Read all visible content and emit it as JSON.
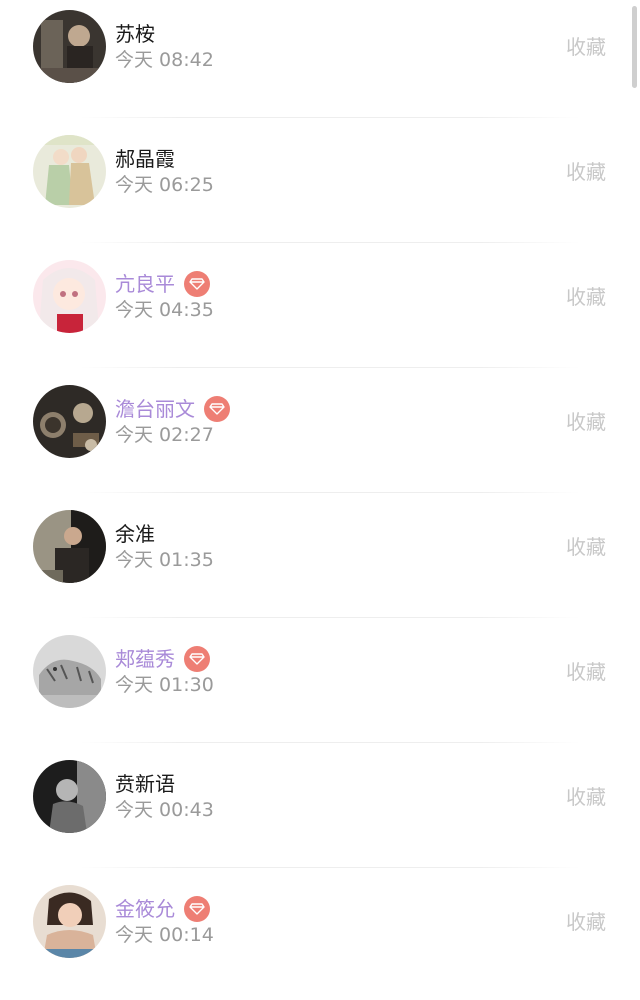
{
  "colors": {
    "vip_name": "#a98ad8",
    "vip_badge": "#ee7e74",
    "normal_name": "#1a1a1a",
    "time": "#9a9a9a",
    "favorite": "#c8c8c8"
  },
  "items": [
    {
      "name": "苏桉",
      "time": "今天 08:42",
      "favorite_label": "收藏",
      "vip": false,
      "badge_icon": "",
      "avatar": "dark-photo-avatar"
    },
    {
      "name": "郝晶霞",
      "time": "今天 06:25",
      "favorite_label": "收藏",
      "vip": false,
      "badge_icon": "",
      "avatar": "illustrated-couple-avatar"
    },
    {
      "name": "亢良平",
      "time": "今天 04:35",
      "favorite_label": "收藏",
      "vip": true,
      "badge_icon": "diamond-icon",
      "avatar": "anime-girl-avatar"
    },
    {
      "name": "澹台丽文",
      "time": "今天 02:27",
      "favorite_label": "收藏",
      "vip": true,
      "badge_icon": "diamond-icon",
      "avatar": "tea-table-avatar"
    },
    {
      "name": "余准",
      "time": "今天 01:35",
      "favorite_label": "收藏",
      "vip": false,
      "badge_icon": "",
      "avatar": "person-photo-avatar"
    },
    {
      "name": "郏蕴秀",
      "time": "今天 01:30",
      "favorite_label": "收藏",
      "vip": true,
      "badge_icon": "diamond-icon",
      "avatar": "tiger-sketch-avatar"
    },
    {
      "name": "贲新语",
      "time": "今天 00:43",
      "favorite_label": "收藏",
      "vip": false,
      "badge_icon": "",
      "avatar": "black-white-portrait-avatar"
    },
    {
      "name": "金筱允",
      "time": "今天 00:14",
      "favorite_label": "收藏",
      "vip": true,
      "badge_icon": "diamond-icon",
      "avatar": "woman-portrait-avatar"
    }
  ]
}
